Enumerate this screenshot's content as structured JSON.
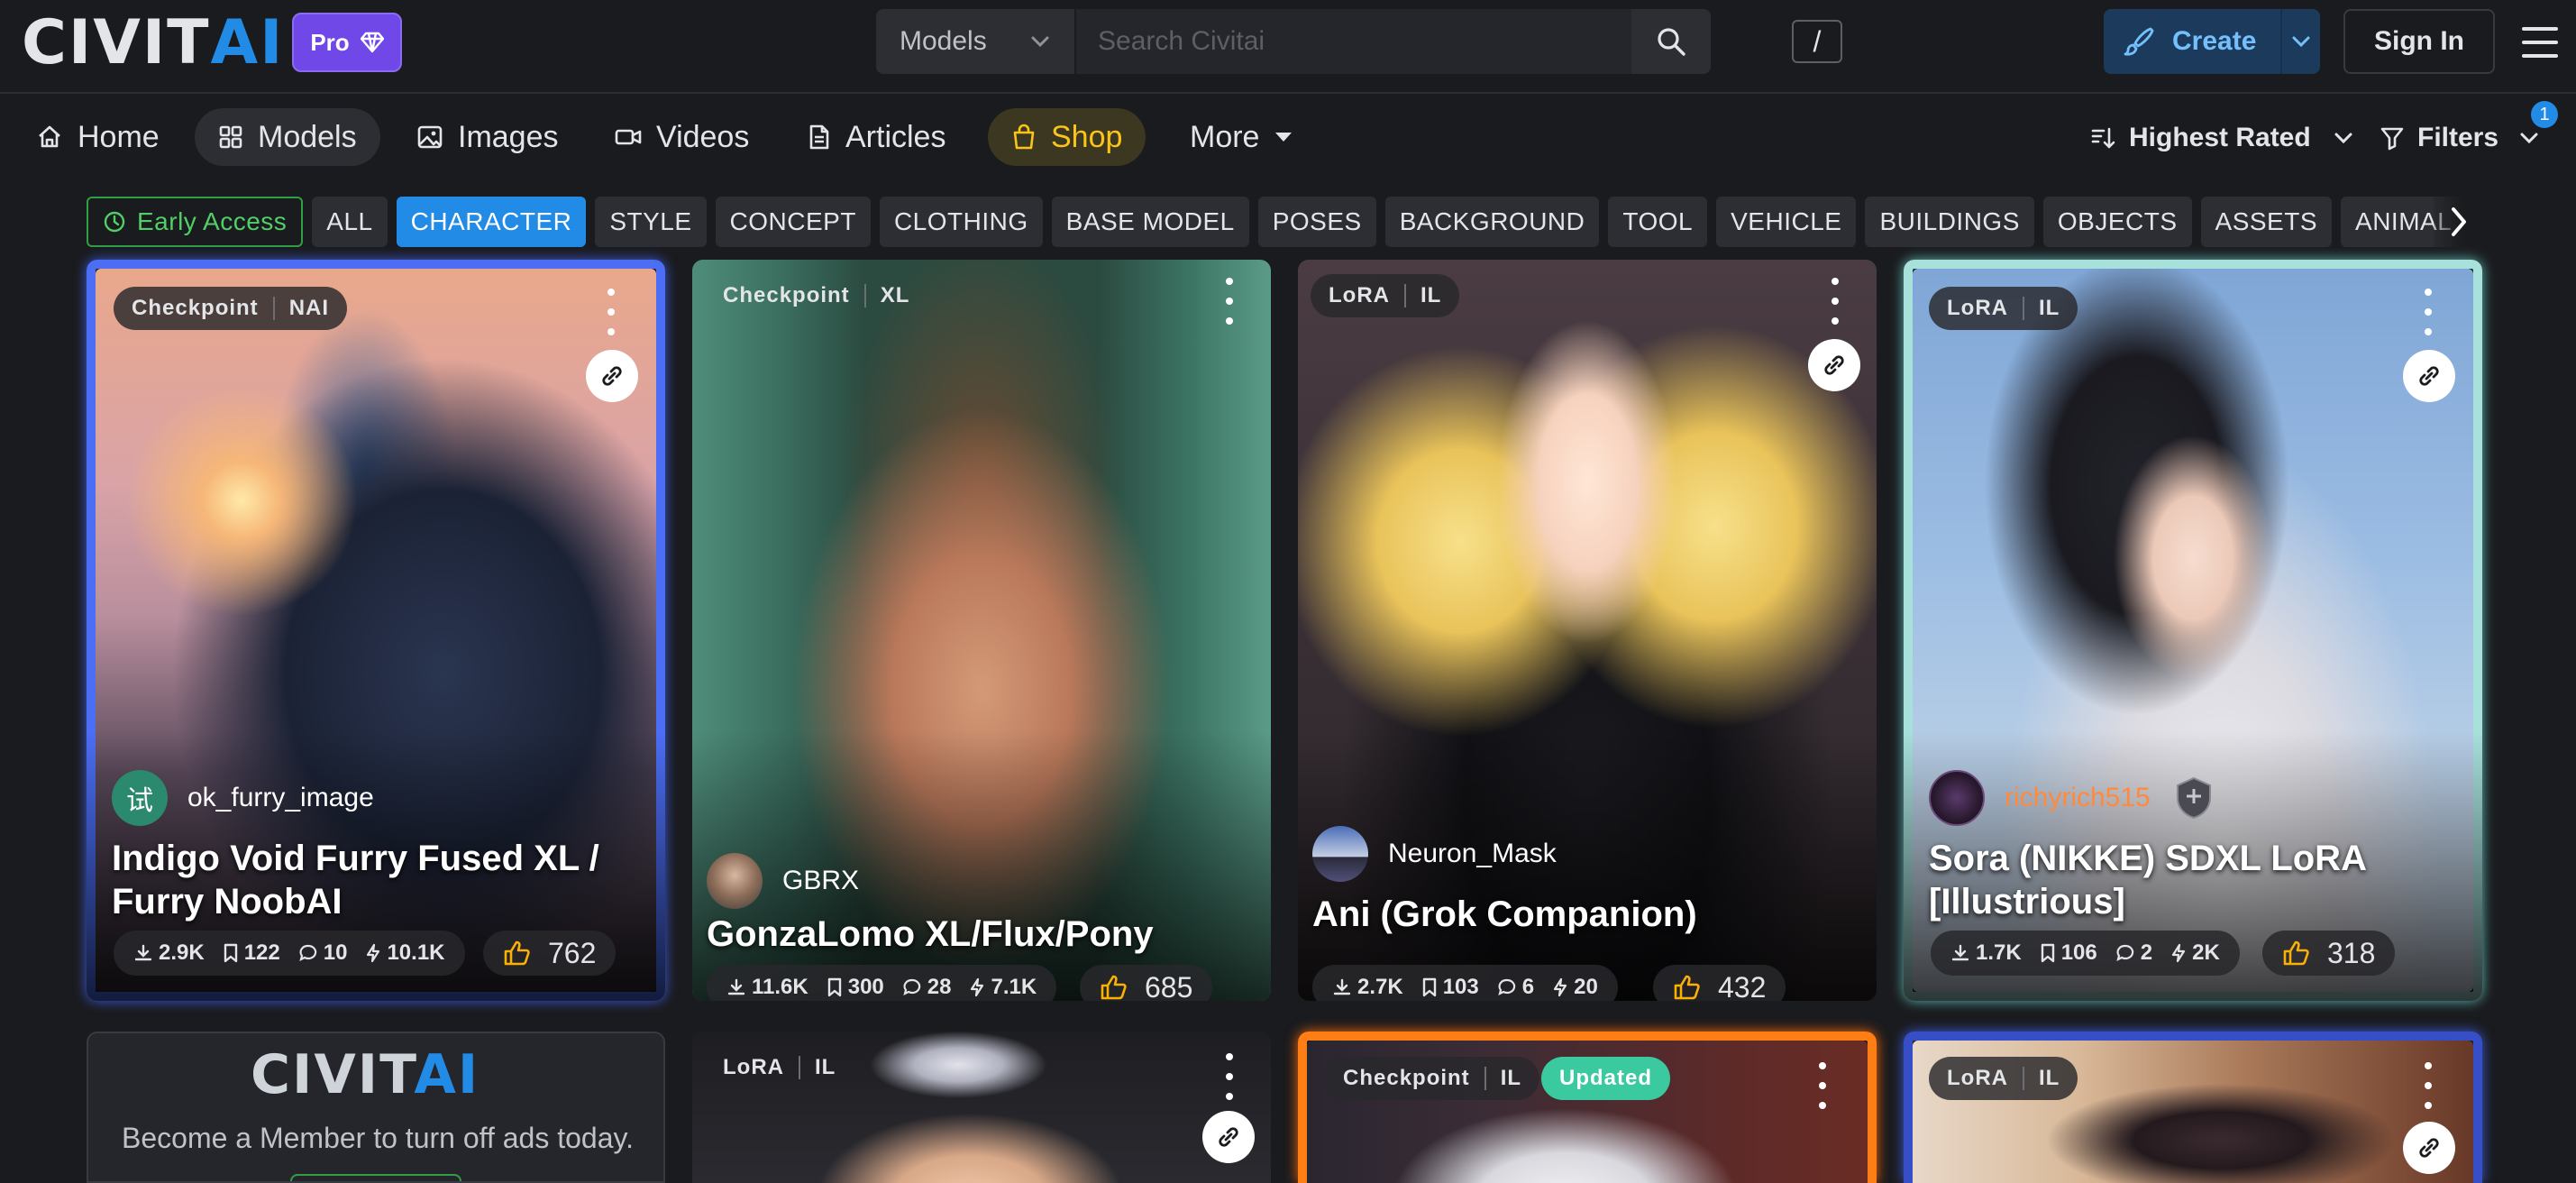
{
  "header": {
    "logo": {
      "part1": "CIVIT",
      "part2": "AI"
    },
    "pro_label": "Pro",
    "search_scope": "Models",
    "search_placeholder": "Search Civitai",
    "search_shortcut": "/",
    "create_label": "Create",
    "signin_label": "Sign In"
  },
  "nav": {
    "items": [
      {
        "label": "Home",
        "icon": "home-icon"
      },
      {
        "label": "Models",
        "icon": "layout-grid-icon"
      },
      {
        "label": "Images",
        "icon": "photo-icon"
      },
      {
        "label": "Videos",
        "icon": "video-icon"
      },
      {
        "label": "Articles",
        "icon": "file-text-icon"
      },
      {
        "label": "Shop",
        "icon": "shopping-bag-icon"
      },
      {
        "label": "More",
        "icon": "caret-down-icon"
      }
    ],
    "active": "Models",
    "sort_label": "Highest Rated",
    "filters_label": "Filters",
    "filters_count": "1"
  },
  "categories": {
    "early_access": "Early Access",
    "items": [
      "ALL",
      "CHARACTER",
      "STYLE",
      "CONCEPT",
      "CLOTHING",
      "BASE MODEL",
      "POSES",
      "BACKGROUND",
      "TOOL",
      "VEHICLE",
      "BUILDINGS",
      "OBJECTS",
      "ASSETS",
      "ANIMAL"
    ],
    "selected": "CHARACTER"
  },
  "cards": [
    {
      "type": "Checkpoint",
      "base": "NAI",
      "creator": "ok_furry_image",
      "creator_avatar_text": "试",
      "title": "Indigo Void Furry Fused XL / Furry NoobAI",
      "downloads": "2.9K",
      "saves": "122",
      "comments": "10",
      "buzz": "10.1K",
      "likes": "762",
      "frame_color": "#4c6ef5"
    },
    {
      "type": "Checkpoint",
      "base": "XL",
      "creator": "GBRX",
      "title": "GonzaLomo XL/Flux/Pony",
      "downloads": "11.6K",
      "saves": "300",
      "comments": "28",
      "buzz": "7.1K",
      "likes": "685"
    },
    {
      "type": "LoRA",
      "base": "IL",
      "creator": "Neuron_Mask",
      "title": "Ani (Grok Companion)",
      "downloads": "2.7K",
      "saves": "103",
      "comments": "6",
      "buzz": "20",
      "likes": "432"
    },
    {
      "type": "LoRA",
      "base": "IL",
      "creator": "richyrich515",
      "title": "Sora (NIKKE) SDXL LoRA [Illustrious]",
      "downloads": "1.7K",
      "saves": "106",
      "comments": "2",
      "buzz": "2K",
      "likes": "318",
      "frame_color": "#8fd3d0"
    }
  ],
  "row2_cards": [
    {
      "type": "LoRA",
      "base": "IL"
    },
    {
      "type": "Checkpoint",
      "base": "IL",
      "badge": "Updated",
      "frame_color": "#f76707"
    },
    {
      "type": "LoRA",
      "base": "IL",
      "frame_color": "#3b5bdb"
    }
  ],
  "member_ad": {
    "logo_part1": "CIVIT",
    "logo_part2": "AI",
    "text": "Become a Member to turn off ads today."
  },
  "colors": {
    "background": "#1a1b1e",
    "accent_blue": "#228be6",
    "pro_purple": "#7048e8",
    "shop_yellow": "#fcc419",
    "early_access_green": "#51cf66",
    "updated_green": "#3bc9a0"
  }
}
